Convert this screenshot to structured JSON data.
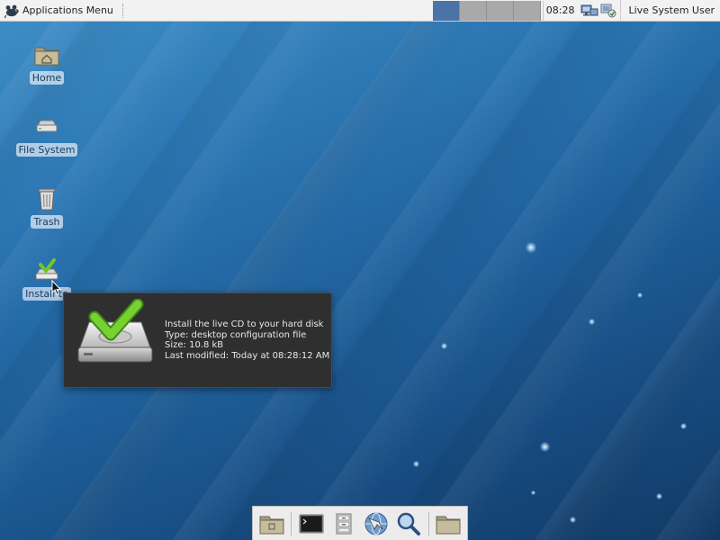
{
  "top_panel": {
    "app_menu_label": "Applications Menu",
    "workspaces": [
      "1",
      "2",
      "3",
      "4"
    ],
    "active_workspace": 1,
    "clock": "08:28",
    "user": "Live System User",
    "tray_icons": [
      "network-icon",
      "update-notifier-icon"
    ]
  },
  "desktop": {
    "icons": [
      {
        "name": "home",
        "label": "Home",
        "icon": "folder-home-icon"
      },
      {
        "name": "file-system",
        "label": "File System",
        "icon": "drive-icon"
      },
      {
        "name": "trash",
        "label": "Trash",
        "icon": "trash-icon"
      },
      {
        "name": "install",
        "label": "Install to Hard Drive",
        "label_visible": "Install to",
        "icon": "installer-icon"
      }
    ]
  },
  "tooltip": {
    "title": "Install the live CD to your hard disk",
    "type": "Type: desktop configuration file",
    "size": "Size: 10.8 kB",
    "modified": "Last modified: Today at 08:28:12 AM"
  },
  "dock": {
    "items": [
      "show-desktop-icon",
      "terminal-icon",
      "file-manager-icon",
      "web-browser-icon",
      "app-finder-icon",
      "folder-icon"
    ]
  },
  "colors": {
    "desktop_bg": "#1e5f9a",
    "active_workspace": "#4a74a8",
    "panel_bg": "#f2f2f2"
  }
}
